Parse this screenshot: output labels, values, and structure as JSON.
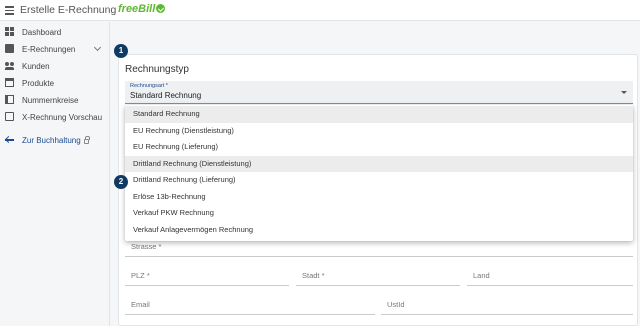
{
  "header": {
    "title": "Erstelle E-Rechnung",
    "logo_free": "freeBill",
    "logo_bill": "",
    "brand_green": "#5fb833",
    "brand_blue": "#1d4a8f"
  },
  "sidebar": {
    "items": [
      {
        "label": "Dashboard",
        "icon": "dashboard-icon"
      },
      {
        "label": "E-Rechnungen",
        "icon": "invoice-icon"
      },
      {
        "label": "Kunden",
        "icon": "people-icon"
      },
      {
        "label": "Produkte",
        "icon": "box-icon"
      },
      {
        "label": "Nummernkreise",
        "icon": "book-icon"
      },
      {
        "label": "X-Rechnung Vorschau",
        "icon": "code-icon"
      }
    ],
    "back_link": {
      "label": "Zur Buchhaltung",
      "icon": "arrow-left-icon"
    }
  },
  "main": {
    "step1": "1",
    "step2": "2",
    "section_title": "Rechnungstyp",
    "select": {
      "label": "Rechnungsart *",
      "value": "Standard Rechnung"
    },
    "options": [
      "Standard Rechnung",
      "EU Rechnung (Dienstleistung)",
      "EU Rechnung (Lieferung)",
      "Drittland Rechnung (Dienstleistung)",
      "Drittland Rechnung (Lieferung)",
      "Erlöse 13b-Rechnung",
      "Verkauf PKW Rechnung",
      "Verkauf Anlagevermögen Rechnung"
    ],
    "fields": {
      "strasse": "Strasse *",
      "plz": "PLZ *",
      "stadt": "Stadt *",
      "land": "Land",
      "email": "Email",
      "ustid": "UstId"
    }
  }
}
